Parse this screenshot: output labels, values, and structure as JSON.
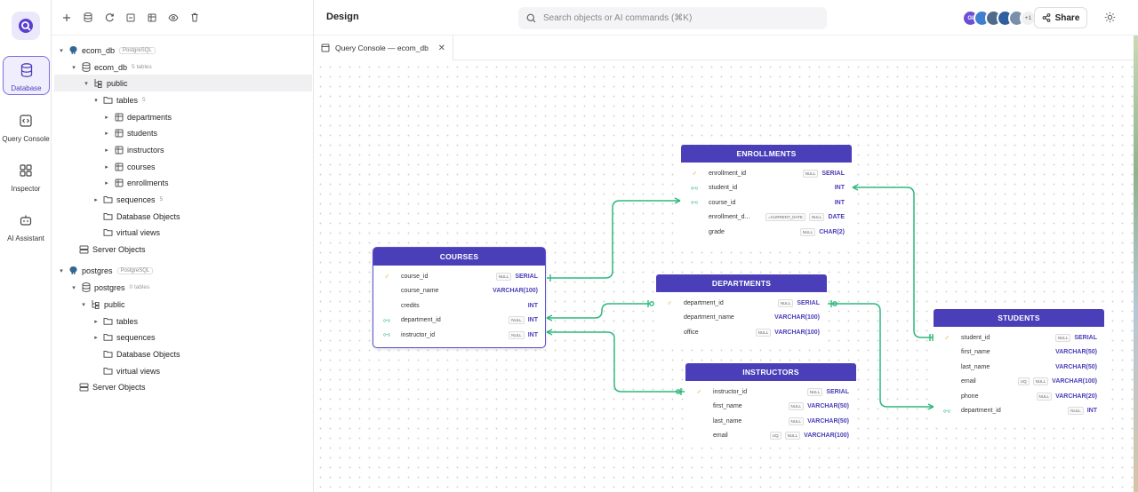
{
  "app": {
    "header_title": "Design",
    "search_placeholder": "Search objects or AI commands (⌘K)",
    "share_label": "Share",
    "avatars": [
      {
        "initials": "GI",
        "color": "#6d4fd6"
      },
      {
        "initials": "",
        "color": "#3f7fd1"
      },
      {
        "initials": "",
        "color": "#506a8a"
      },
      {
        "initials": "",
        "color": "#2f5f9f"
      },
      {
        "initials": "",
        "color": "#7a90a8"
      }
    ],
    "avatars_more": "+1",
    "tab_label": "Query Console — ecom_db"
  },
  "rail": {
    "items": [
      {
        "label": "Database"
      },
      {
        "label": "Query Console"
      },
      {
        "label": "Inspector"
      },
      {
        "label": "AI Assistant"
      }
    ]
  },
  "tree": {
    "ecom_db": "ecom_db",
    "postgres_badge": "PostgreSQL",
    "ecom_db_schema": "ecom_db",
    "ecom_db_schema_count": "5 tables",
    "public": "public",
    "tables": "tables",
    "tables_count": "5",
    "table_items": [
      "departments",
      "students",
      "instructors",
      "courses",
      "enrollments"
    ],
    "sequences": "sequences",
    "sequences_count": "5",
    "database_objects": "Database Objects",
    "virtual_views": "virtual views",
    "server_objects": "Server Objects",
    "postgres": "postgres",
    "postgres_badge2": "PostgreSQL",
    "postgres_schema": "postgres",
    "postgres_schema_count": "0 tables",
    "public2": "public",
    "tables2": "tables",
    "sequences2": "sequences",
    "database_objects2": "Database Objects",
    "virtual_views2": "virtual views",
    "server_objects2": "Server Objects"
  },
  "entities": {
    "enrollments": {
      "title": "ENROLLMENTS",
      "columns": [
        {
          "name": "enrollment_id",
          "key": "pk",
          "tags": [
            "NULL"
          ],
          "type": "SERIAL"
        },
        {
          "name": "student_id",
          "key": "fk",
          "tags": [],
          "type": "INT"
        },
        {
          "name": "course_id",
          "key": "fk",
          "tags": [],
          "type": "INT"
        },
        {
          "name": "enrollment_d...",
          "key": "",
          "tags": [
            "=CURRENT_DATE",
            "NULL"
          ],
          "type": "DATE"
        },
        {
          "name": "grade",
          "key": "",
          "tags": [
            "NULL"
          ],
          "type": "CHAR(2)"
        }
      ]
    },
    "courses": {
      "title": "COURSES",
      "columns": [
        {
          "name": "course_id",
          "key": "pk",
          "tags": [
            "NULL"
          ],
          "type": "SERIAL"
        },
        {
          "name": "course_name",
          "key": "",
          "tags": [],
          "type": "VARCHAR(100)"
        },
        {
          "name": "credits",
          "key": "",
          "tags": [],
          "type": "INT"
        },
        {
          "name": "department_id",
          "key": "fk",
          "tags": [
            "NULL"
          ],
          "type": "INT"
        },
        {
          "name": "instructor_id",
          "key": "fk",
          "tags": [
            "NULL"
          ],
          "type": "INT"
        }
      ]
    },
    "departments": {
      "title": "DEPARTMENTS",
      "columns": [
        {
          "name": "department_id",
          "key": "pk",
          "tags": [
            "NULL"
          ],
          "type": "SERIAL"
        },
        {
          "name": "department_name",
          "key": "",
          "tags": [],
          "type": "VARCHAR(100)"
        },
        {
          "name": "office",
          "key": "",
          "tags": [
            "NULL"
          ],
          "type": "VARCHAR(100)"
        }
      ]
    },
    "instructors": {
      "title": "INSTRUCTORS",
      "columns": [
        {
          "name": "instructor_id",
          "key": "pk",
          "tags": [
            "NULL"
          ],
          "type": "SERIAL"
        },
        {
          "name": "first_name",
          "key": "",
          "tags": [
            "NULL"
          ],
          "type": "VARCHAR(50)"
        },
        {
          "name": "last_name",
          "key": "",
          "tags": [
            "NULL"
          ],
          "type": "VARCHAR(50)"
        },
        {
          "name": "email",
          "key": "",
          "tags": [
            "UQ",
            "NULL"
          ],
          "type": "VARCHAR(100)"
        }
      ]
    },
    "students": {
      "title": "STUDENTS",
      "columns": [
        {
          "name": "student_id",
          "key": "pk",
          "tags": [
            "NULL"
          ],
          "type": "SERIAL"
        },
        {
          "name": "first_name",
          "key": "",
          "tags": [],
          "type": "VARCHAR(50)"
        },
        {
          "name": "last_name",
          "key": "",
          "tags": [],
          "type": "VARCHAR(50)"
        },
        {
          "name": "email",
          "key": "",
          "tags": [
            "UQ",
            "NULL"
          ],
          "type": "VARCHAR(100)"
        },
        {
          "name": "phone",
          "key": "",
          "tags": [
            "NULL"
          ],
          "type": "VARCHAR(20)"
        },
        {
          "name": "department_id",
          "key": "fk",
          "tags": [
            "NULL"
          ],
          "type": "INT"
        }
      ]
    }
  },
  "colors": {
    "accent": "#4a3fb8",
    "connector": "#2db87d",
    "pk": "#e0a030"
  }
}
